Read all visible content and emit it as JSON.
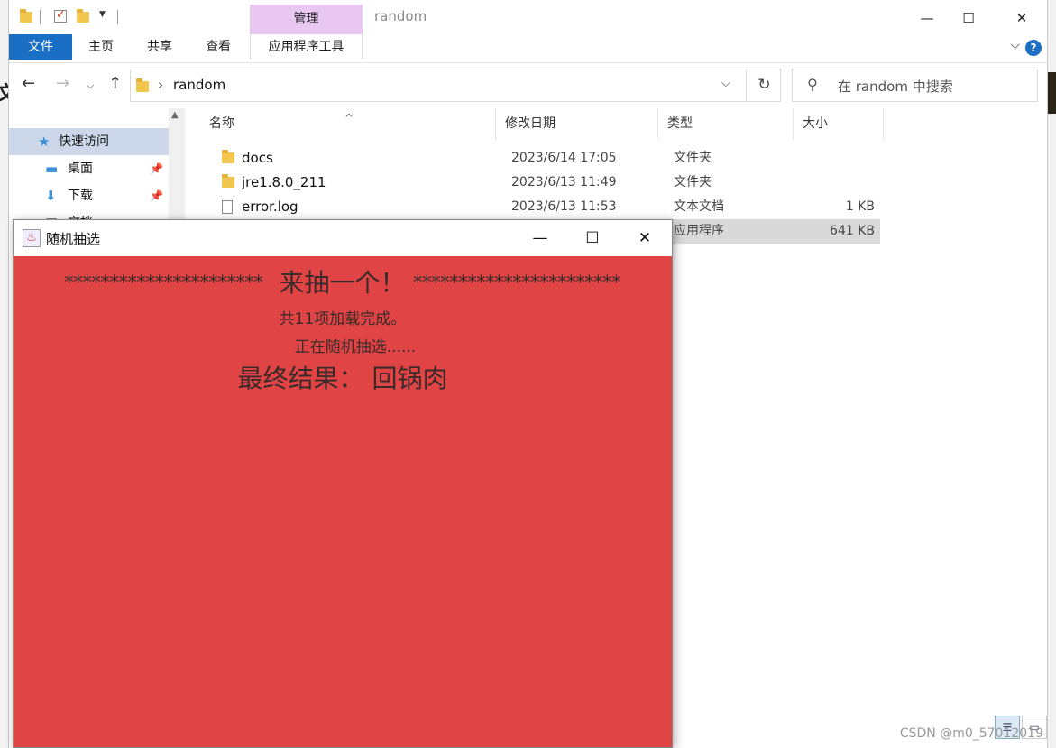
{
  "explorer": {
    "title": "random",
    "context_tab": "管理",
    "ribbon_tabs": {
      "file": "文件",
      "home": "主页",
      "share": "共享",
      "view": "查看",
      "app_tools": "应用程序工具"
    },
    "address": {
      "path_folder": "random"
    },
    "search": {
      "placeholder": "在 random 中搜索"
    },
    "nav": {
      "quick_access": "快速访问",
      "desktop": "桌面",
      "downloads": "下载",
      "documents": "文档"
    },
    "columns": {
      "name": "名称",
      "date": "修改日期",
      "type": "类型",
      "size": "大小"
    },
    "files": [
      {
        "name": "docs",
        "date": "2023/6/14 17:05",
        "type": "文件夹",
        "size": ""
      },
      {
        "name": "jre1.8.0_211",
        "date": "2023/6/13 11:49",
        "type": "文件夹",
        "size": ""
      },
      {
        "name": "error.log",
        "date": "2023/6/13 11:53",
        "type": "文本文档",
        "size": "1 KB"
      },
      {
        "name": "",
        "date": "",
        "type": "应用程序",
        "size": "641 KB"
      }
    ]
  },
  "app": {
    "title": "随机抽选",
    "banner_stars_left": "**********************",
    "banner_text": "来抽一个！",
    "banner_stars_right": "***********************",
    "loaded_text": "共11项加载完成。",
    "drawing_text": "正在随机抽选......",
    "result_label": "最终结果：",
    "result_value": "回锅肉",
    "background_color": "#e04444"
  },
  "watermark": "CSDN @m0_57012019"
}
